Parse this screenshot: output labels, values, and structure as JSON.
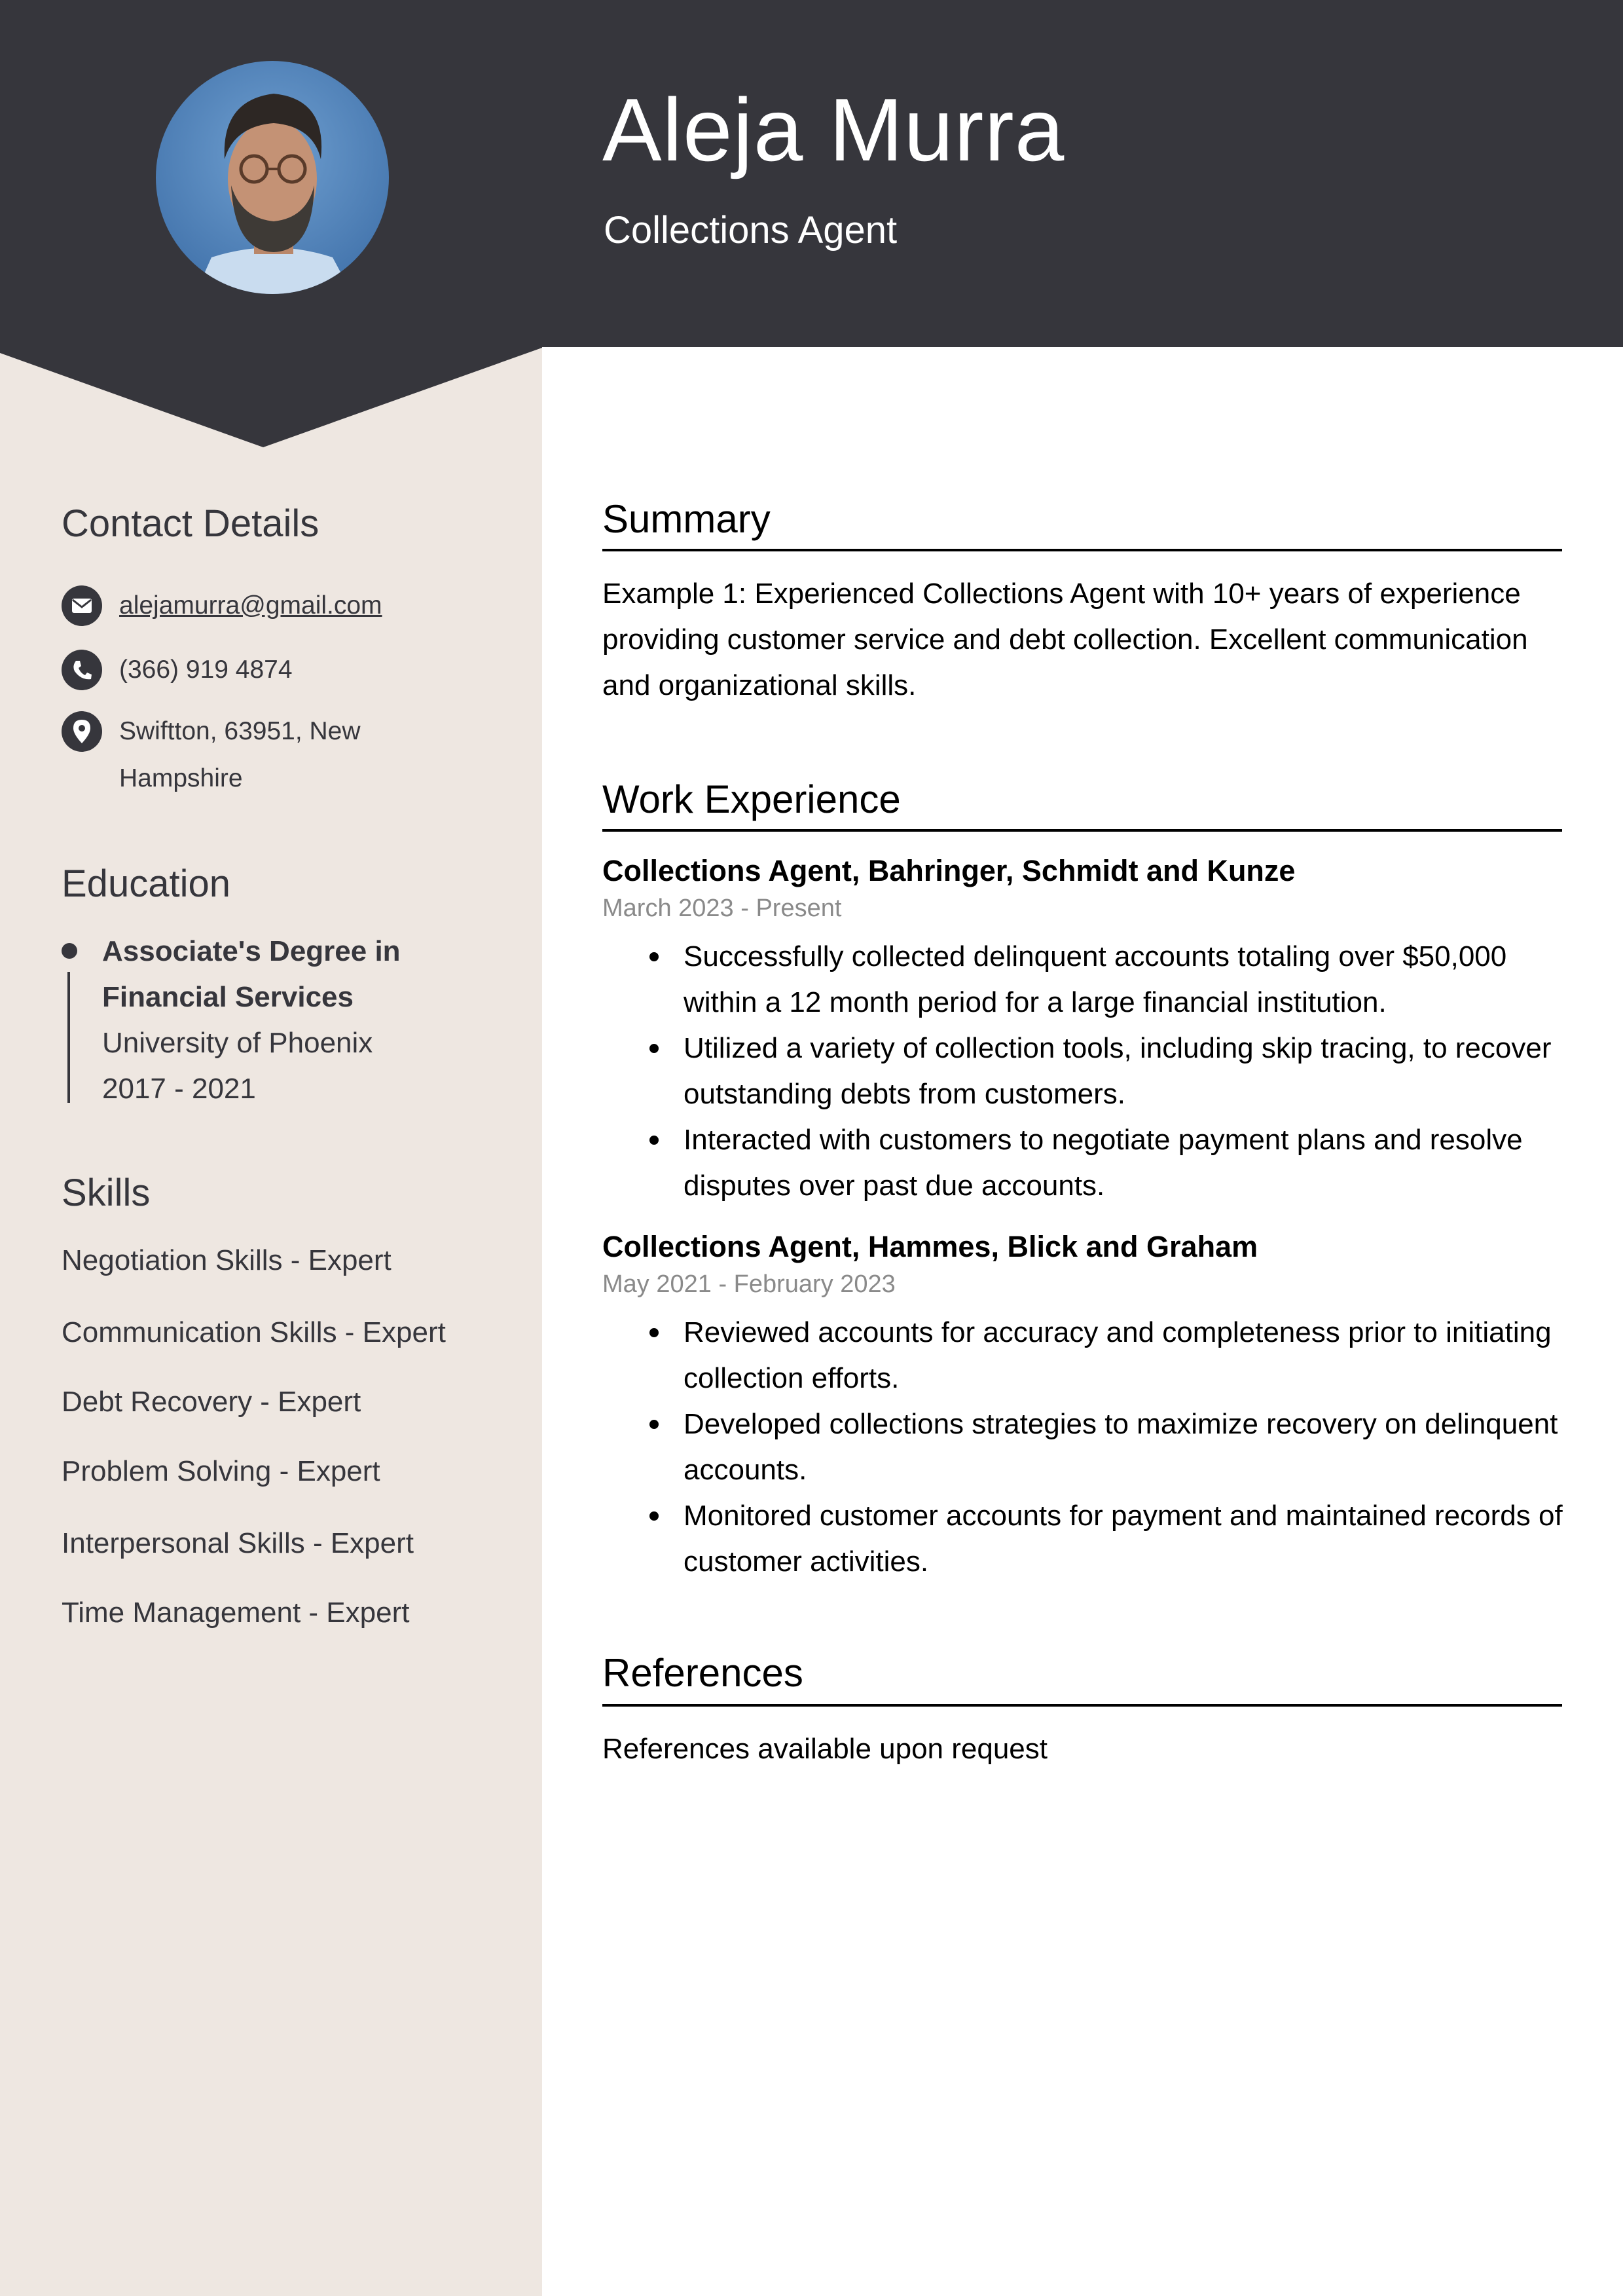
{
  "header": {
    "name": "Aleja Murra",
    "title": "Collections Agent",
    "photo_alt": "profile-photo"
  },
  "colors": {
    "header_bg": "#36363c",
    "sidebar_bg": "#eee7e1",
    "text_dark": "#36363c",
    "date_gray": "#8a8a8a"
  },
  "sidebar": {
    "contact": {
      "heading": "Contact Details",
      "email": "alejamurra@gmail.com",
      "phone": "(366) 919 4874",
      "address_line1": "Swiftton, 63951, New",
      "address_line2": "Hampshire",
      "icons": [
        "envelope-icon",
        "phone-icon",
        "location-pin-icon"
      ]
    },
    "education": {
      "heading": "Education",
      "degree_line1": "Associate's Degree in",
      "degree_line2": "Financial Services",
      "school": "University of Phoenix",
      "years": "2017 - 2021"
    },
    "skills": {
      "heading": "Skills",
      "items": [
        "Negotiation Skills - Expert",
        "Communication Skills - Expert",
        "Debt Recovery - Expert",
        "Problem Solving - Expert",
        "Interpersonal Skills - Expert",
        "Time Management - Expert"
      ]
    }
  },
  "main": {
    "summary": {
      "heading": "Summary",
      "text": "Example 1: Experienced Collections Agent with 10+ years of experience providing customer service and debt collection. Excellent communication and organizational skills."
    },
    "experience": {
      "heading": "Work Experience",
      "jobs": [
        {
          "title": "Collections Agent, Bahringer, Schmidt and Kunze",
          "dates": "March 2023 - Present",
          "bullets": [
            "Successfully collected delinquent accounts totaling over $50,000 within a 12 month period for a large financial institution.",
            "Utilized a variety of collection tools, including skip tracing, to recover outstanding debts from customers.",
            "Interacted with customers to negotiate payment plans and resolve disputes over past due accounts."
          ]
        },
        {
          "title": "Collections Agent, Hammes, Blick and Graham",
          "dates": "May 2021 - February 2023",
          "bullets": [
            "Reviewed accounts for accuracy and completeness prior to initiating collection efforts.",
            "Developed collections strategies to maximize recovery on delinquent accounts.",
            "Monitored customer accounts for payment and maintained records of customer activities."
          ]
        }
      ]
    },
    "references": {
      "heading": "References",
      "text": "References available upon request"
    }
  }
}
